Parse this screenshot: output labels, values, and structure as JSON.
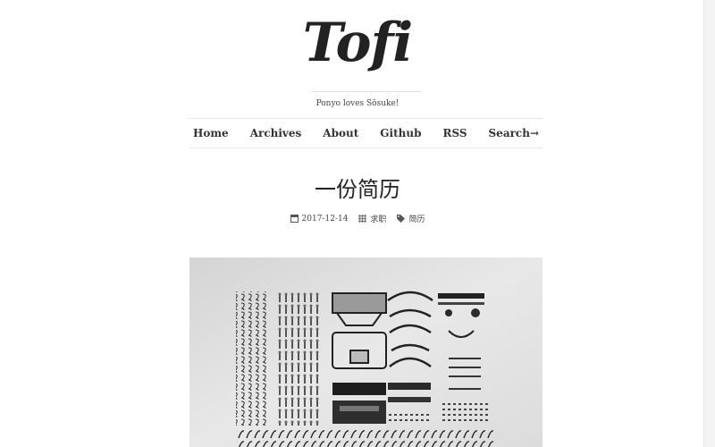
{
  "site": {
    "logo_text": "Tofi",
    "tagline": "Ponyo loves Sōsuke!"
  },
  "nav": {
    "items": [
      {
        "label": "Home"
      },
      {
        "label": "Archives"
      },
      {
        "label": "About"
      },
      {
        "label": "Github"
      },
      {
        "label": "RSS"
      },
      {
        "label": "Search→"
      }
    ]
  },
  "post": {
    "title": "一份简历",
    "date": "2017-12-14",
    "category": "求职",
    "tag": "简历"
  },
  "hero_image": {
    "icon": "disassembled-typewriter-photo"
  }
}
